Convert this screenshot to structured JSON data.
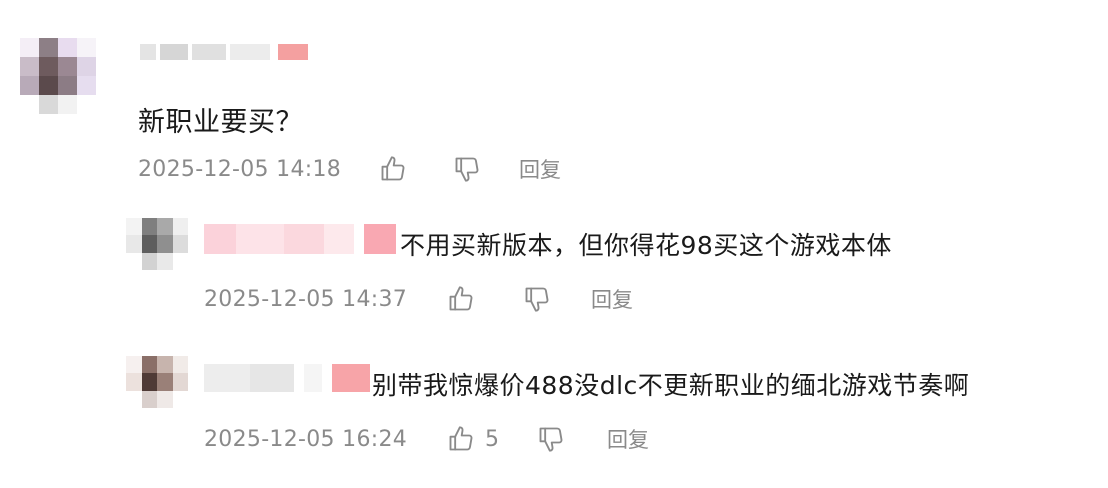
{
  "comment": {
    "text": "新职业要买？",
    "timestamp": "2025-12-05 14:18",
    "reply_label": "回复",
    "icons": [
      "thumbs-up-icon",
      "thumbs-down-icon"
    ]
  },
  "replies": [
    {
      "text": "不用买新版本，但你得花98买这个游戏本体",
      "timestamp": "2025-12-05 14:37",
      "reply_label": "回复"
    },
    {
      "text": "别带我惊爆价488没dlc不更新职业的缅北游戏节奏啊",
      "timestamp": "2025-12-05 16:24",
      "like_count": "5",
      "reply_label": "回复"
    }
  ],
  "colors": {
    "text": "#1a1a1a",
    "meta": "#8a8a8a",
    "background": "#ffffff"
  }
}
